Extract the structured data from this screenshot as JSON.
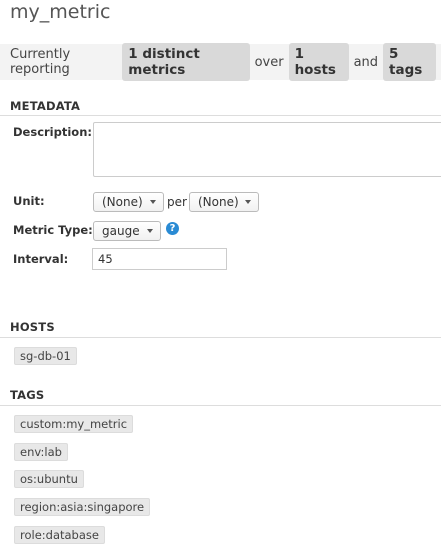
{
  "page_title": "my_metric",
  "summary": {
    "prefix": "Currently reporting",
    "metrics": "1 distinct metrics",
    "over": "over",
    "hosts": "1 hosts",
    "and": "and",
    "tags": "5 tags"
  },
  "metadata": {
    "heading": "METADATA",
    "description_label": "Description:",
    "description_value": "",
    "unit_label": "Unit:",
    "unit_value": "(None)",
    "per_text": "per",
    "per_unit_value": "(None)",
    "metric_type_label": "Metric Type:",
    "metric_type_value": "gauge",
    "help_icon": "question-circle-icon",
    "interval_label": "Interval:",
    "interval_value": "45"
  },
  "hosts": {
    "heading": "HOSTS",
    "items": [
      "sg-db-01"
    ]
  },
  "tags": {
    "heading": "TAGS",
    "items": [
      "custom:my_metric",
      "env:lab",
      "os:ubuntu",
      "region:asia:singapore",
      "role:database"
    ]
  },
  "colors": {
    "summary_bg": "#f3f3f3",
    "pill_bg": "#d9d9d9",
    "help_icon": "#2a8bd4",
    "tag_bg": "#e8e8e8"
  }
}
